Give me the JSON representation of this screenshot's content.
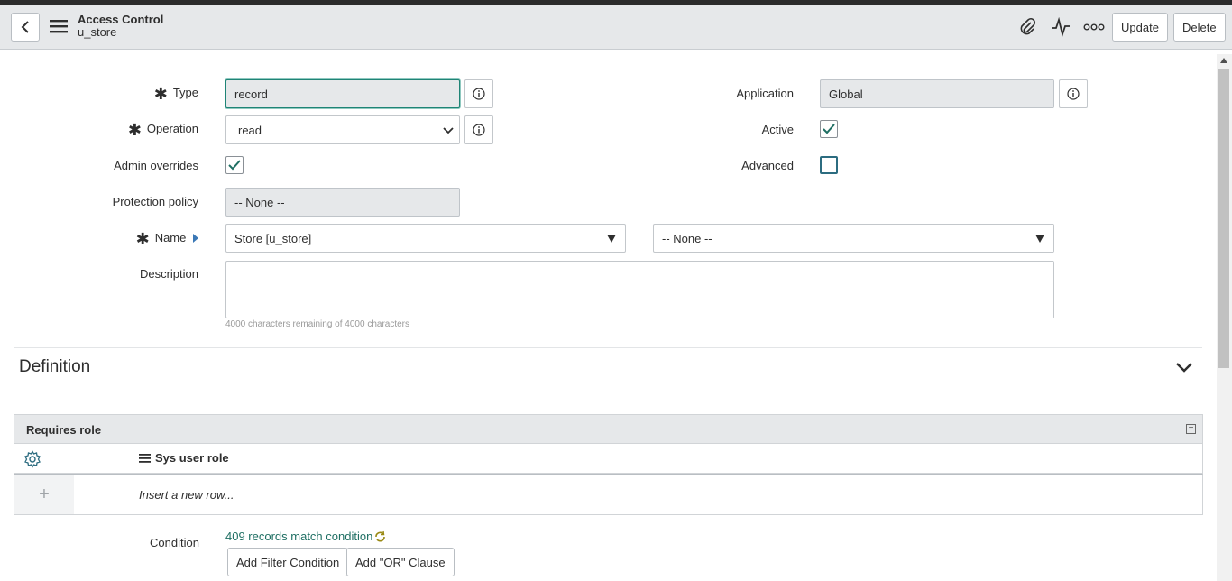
{
  "header": {
    "title": "Access Control",
    "subtitle": "u_store",
    "update_label": "Update",
    "delete_label": "Delete",
    "icons": [
      "back-icon",
      "menu-icon",
      "paperclip-icon",
      "activity-icon",
      "more-icon"
    ]
  },
  "form": {
    "type_label": "Type",
    "type_value": "record",
    "operation_label": "Operation",
    "operation_value": "read",
    "admin_overrides_label": "Admin overrides",
    "admin_overrides_checked": true,
    "protection_label": "Protection policy",
    "protection_value": "-- None --",
    "name_label": "Name",
    "name_value": "Store [u_store]",
    "name_field_value": "-- None --",
    "description_label": "Description",
    "description_value": "",
    "chars_hint": "4000 characters remaining of 4000 characters",
    "application_label": "Application",
    "application_value": "Global",
    "active_label": "Active",
    "active_checked": true,
    "advanced_label": "Advanced",
    "advanced_checked": false
  },
  "definition": {
    "title": "Definition"
  },
  "requires_role": {
    "title": "Requires role",
    "column": "Sys user role",
    "insert_row": "Insert a new row..."
  },
  "condition": {
    "label": "Condition",
    "match_text": "409 records match condition",
    "add_filter": "Add Filter Condition",
    "add_or": "Add \"OR\" Clause"
  },
  "colors": {
    "accent": "#1f8476",
    "link": "#1f6f63",
    "header_bg": "#e6e8ea"
  }
}
